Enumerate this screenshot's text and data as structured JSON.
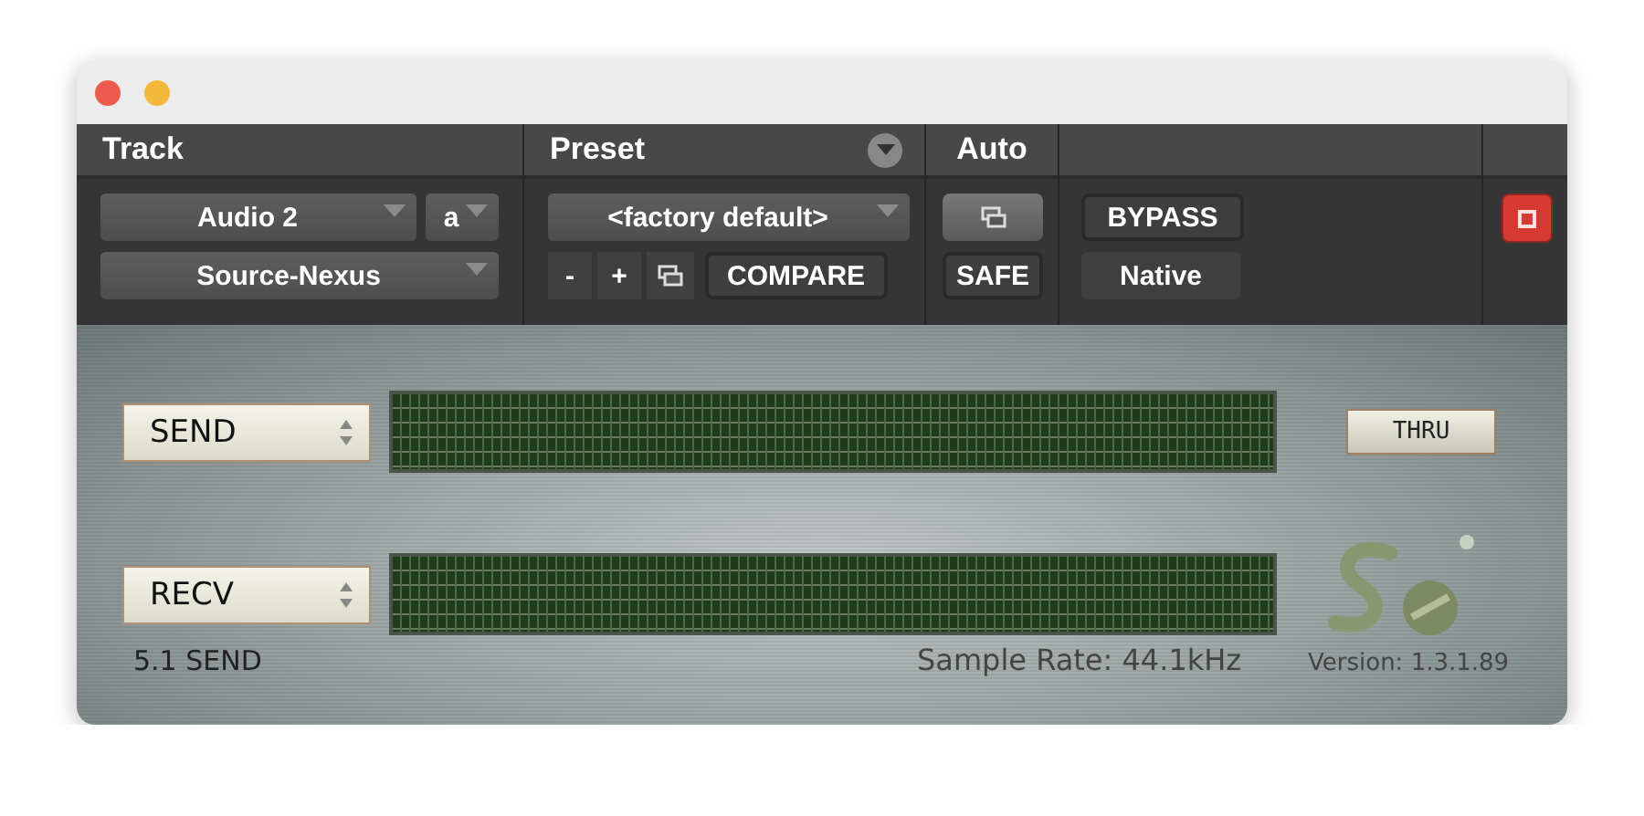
{
  "track": {
    "label": "Track",
    "selectors": [
      {
        "value": "Audio 2"
      },
      {
        "value": "a"
      },
      {
        "value": "Source-Nexus"
      }
    ]
  },
  "preset": {
    "label": "Preset",
    "selector": "<factory default>",
    "buttons": [
      {
        "kind": "text",
        "label": "-"
      },
      {
        "kind": "text",
        "label": "+"
      },
      {
        "kind": "icon"
      },
      {
        "kind": "text",
        "label": "COMPARE"
      }
    ]
  },
  "auto": {
    "label": "Auto",
    "safe": "SAFE"
  },
  "bypass": "BYPASS",
  "platform": "Native",
  "channels": [
    {
      "mode": "SEND"
    },
    {
      "mode": "RECV"
    }
  ],
  "thru": "THRU",
  "footer": {
    "format": "5.1 SEND",
    "sample_rate": "Sample Rate: 44.1kHz",
    "version": "Version: 1.3.1.89"
  }
}
